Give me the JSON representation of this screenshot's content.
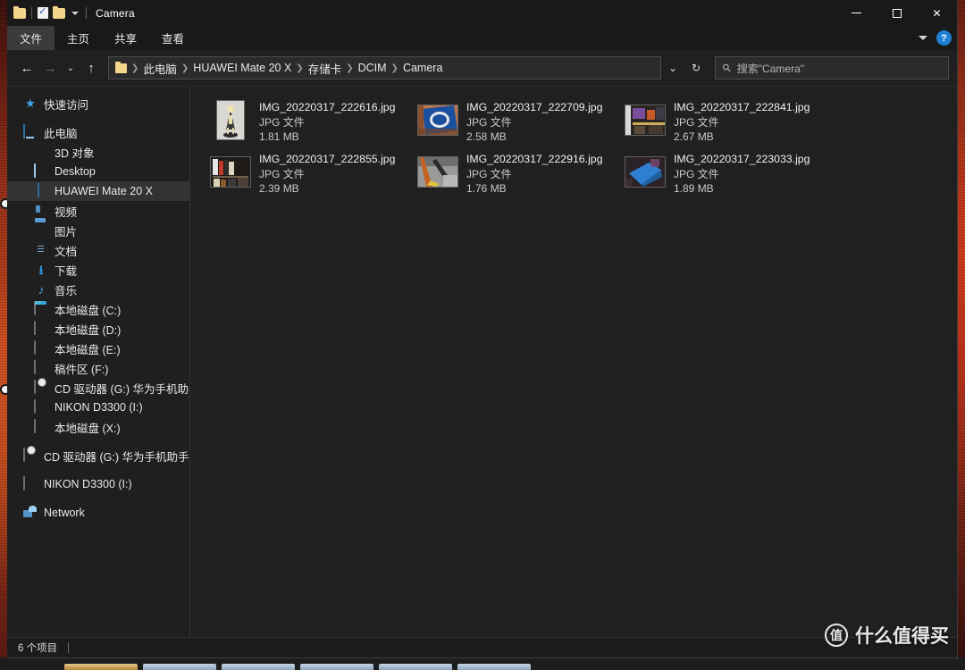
{
  "window": {
    "title": "Camera",
    "quick_access": [
      {
        "name": "folder-icon",
        "label": "文件夹"
      },
      {
        "name": "properties-icon",
        "label": "属性"
      },
      {
        "name": "new-folder-icon",
        "label": "新建文件夹"
      },
      {
        "name": "customize-chevron-icon",
        "label": "自定义快速访问工具栏"
      }
    ],
    "controls": {
      "minimize": "最小化",
      "maximize": "最大化",
      "close": "✕"
    }
  },
  "ribbon": {
    "tabs": [
      {
        "label": "文件",
        "active": true
      },
      {
        "label": "主页",
        "active": false
      },
      {
        "label": "共享",
        "active": false
      },
      {
        "label": "查看",
        "active": false
      }
    ],
    "expand_label": "展开功能区",
    "help_label": "?"
  },
  "address": {
    "back": "←",
    "forward": "→",
    "recent": "⌄",
    "up": "↑",
    "breadcrumbs": [
      "此电脑",
      "HUAWEI Mate 20 X",
      "存储卡",
      "DCIM",
      "Camera"
    ],
    "dropdown": "⌄",
    "refresh": "↻"
  },
  "search": {
    "icon": "search-icon",
    "placeholder": "搜索\"Camera\"",
    "value": "搜索\"Camera\""
  },
  "sidebar": {
    "items": [
      {
        "label": "快速访问",
        "icon": "star-icon",
        "level": 0,
        "selected": false
      },
      {
        "label": "此电脑",
        "icon": "computer-icon",
        "level": 0,
        "selected": false,
        "gap_before": true
      },
      {
        "label": "3D 对象",
        "icon": "3d-objects-icon",
        "level": 1,
        "selected": false
      },
      {
        "label": "Desktop",
        "icon": "desktop-icon",
        "level": 1,
        "selected": false
      },
      {
        "label": "HUAWEI Mate 20 X",
        "icon": "phone-icon",
        "level": 1,
        "selected": true
      },
      {
        "label": "视频",
        "icon": "videos-icon",
        "level": 1,
        "selected": false
      },
      {
        "label": "图片",
        "icon": "pictures-icon",
        "level": 1,
        "selected": false
      },
      {
        "label": "文档",
        "icon": "documents-icon",
        "level": 1,
        "selected": false
      },
      {
        "label": "下载",
        "icon": "downloads-icon",
        "level": 1,
        "selected": false
      },
      {
        "label": "音乐",
        "icon": "music-icon",
        "level": 1,
        "selected": false
      },
      {
        "label": "本地磁盘 (C:)",
        "icon": "system-drive-icon",
        "level": 1,
        "selected": false
      },
      {
        "label": "本地磁盘 (D:)",
        "icon": "drive-icon",
        "level": 1,
        "selected": false
      },
      {
        "label": "本地磁盘 (E:)",
        "icon": "drive-icon",
        "level": 1,
        "selected": false
      },
      {
        "label": "稿件区 (F:)",
        "icon": "drive-icon",
        "level": 1,
        "selected": false
      },
      {
        "label": "CD 驱动器 (G:) 华为手机助手",
        "icon": "cd-drive-icon",
        "level": 1,
        "selected": false
      },
      {
        "label": "NIKON D3300 (I:)",
        "icon": "drive-icon",
        "level": 1,
        "selected": false
      },
      {
        "label": "本地磁盘 (X:)",
        "icon": "drive-icon",
        "level": 1,
        "selected": false
      },
      {
        "label": "CD 驱动器 (G:) 华为手机助手",
        "icon": "cd-drive-icon",
        "level": 0,
        "selected": false,
        "gap_before": true
      },
      {
        "label": "NIKON D3300 (I:)",
        "icon": "drive-icon",
        "level": 0,
        "selected": false,
        "gap_before": true
      },
      {
        "label": "Network",
        "icon": "network-icon",
        "level": 0,
        "selected": false,
        "gap_before": true
      }
    ]
  },
  "files": [
    {
      "name": "IMG_20220317_222616.jpg",
      "type": "JPG 文件",
      "size": "1.81 MB",
      "thumb": "figurine-photo"
    },
    {
      "name": "IMG_20220317_222709.jpg",
      "type": "JPG 文件",
      "size": "2.58 MB",
      "thumb": "blue-package-photo"
    },
    {
      "name": "IMG_20220317_222841.jpg",
      "type": "JPG 文件",
      "size": "2.67 MB",
      "thumb": "shelf-photo"
    },
    {
      "name": "IMG_20220317_222855.jpg",
      "type": "JPG 文件",
      "size": "2.39 MB",
      "thumb": "bookshelf-photo"
    },
    {
      "name": "IMG_20220317_222916.jpg",
      "type": "JPG 文件",
      "size": "1.76 MB",
      "thumb": "desk-photo"
    },
    {
      "name": "IMG_20220317_223033.jpg",
      "type": "JPG 文件",
      "size": "1.89 MB",
      "thumb": "blue-box-photo"
    }
  ],
  "status": {
    "item_count": "6 个项目"
  },
  "watermark": {
    "logo": "值",
    "text": "什么值得买"
  },
  "colors": {
    "window_bg": "#202020",
    "titlebar_bg": "#191919",
    "selected_item": "#333333",
    "accent_blue": "#1e7fd4",
    "text_primary": "#f0f0f0",
    "text_secondary": "#c9c9c9"
  }
}
